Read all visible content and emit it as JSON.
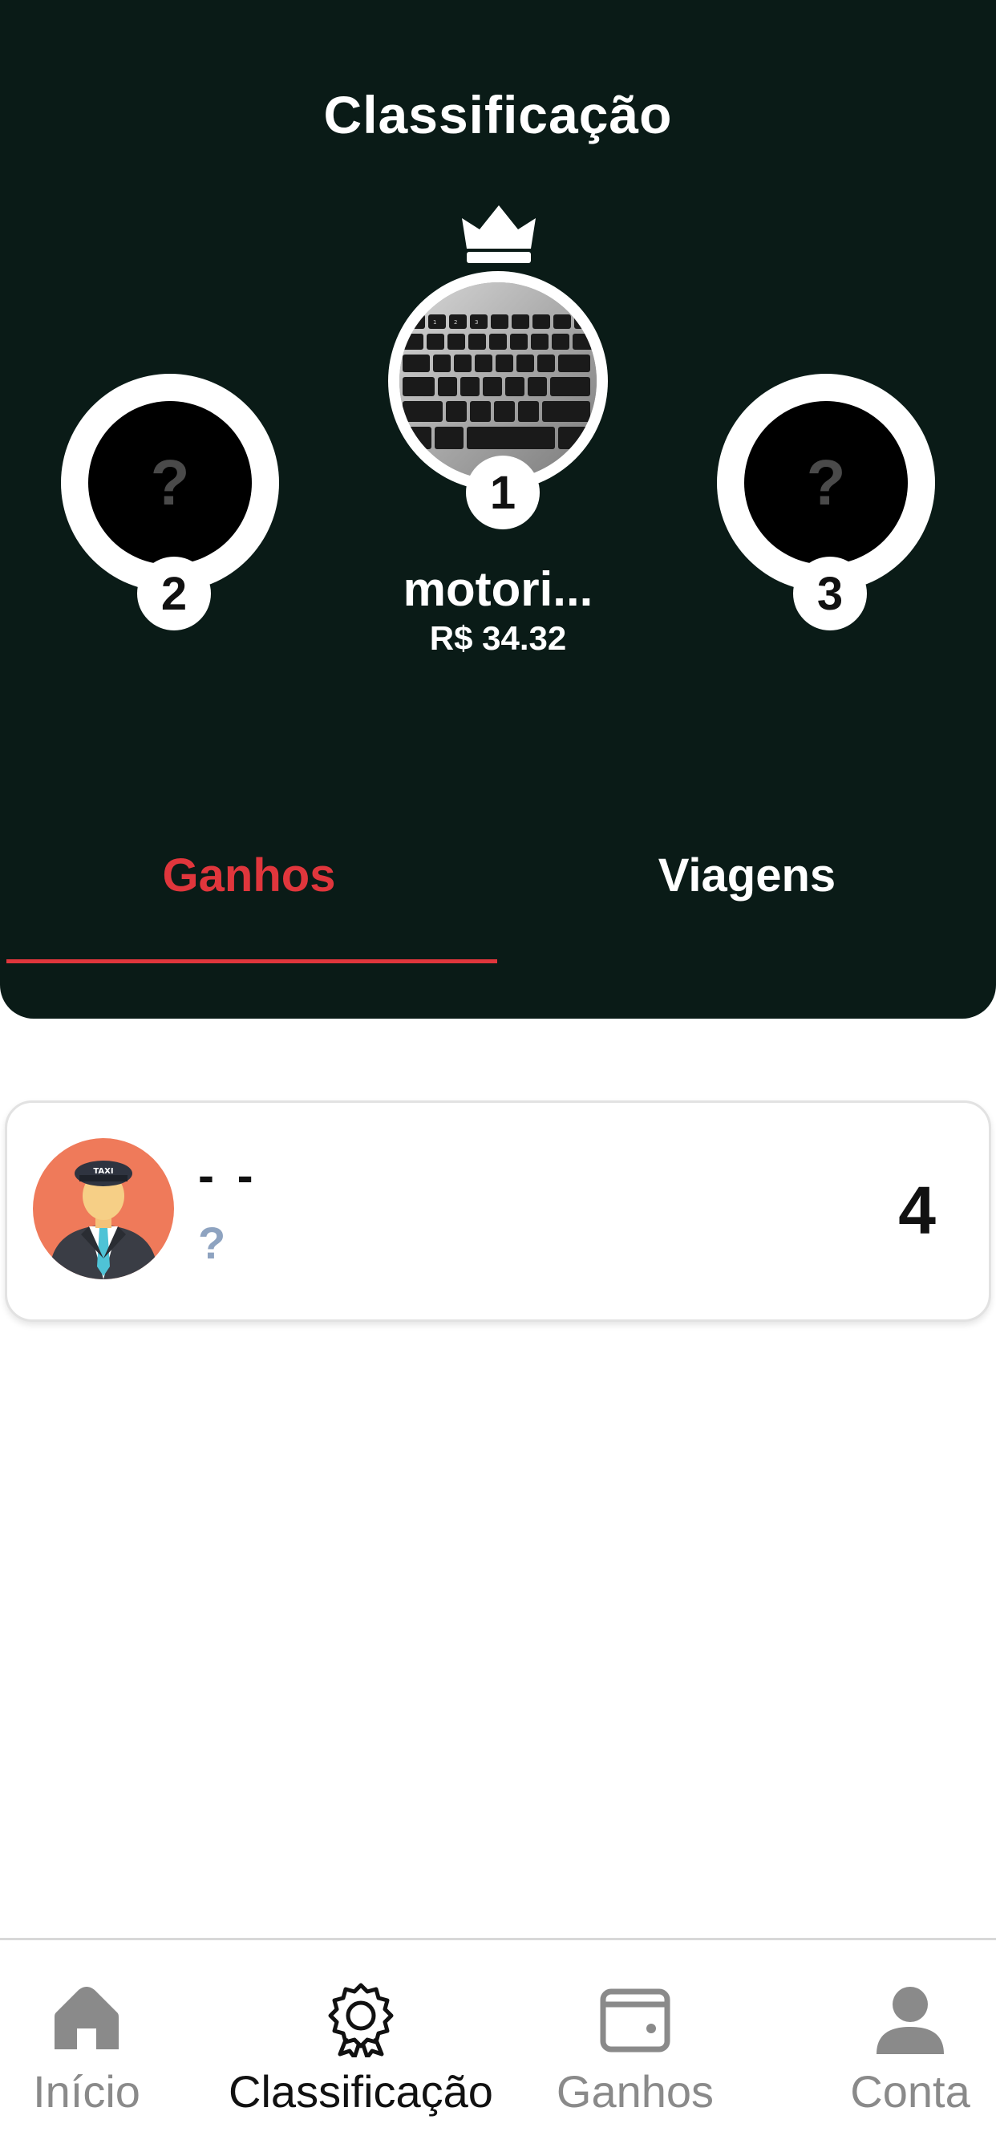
{
  "header": {
    "title": "Classificação"
  },
  "podium": {
    "first": {
      "rank": "1",
      "name": "motori...",
      "value": "R$ 34.32"
    },
    "second": {
      "rank": "2",
      "placeholder": "?"
    },
    "third": {
      "rank": "3",
      "placeholder": "?"
    }
  },
  "tabs": [
    {
      "label": "Ganhos",
      "active": true
    },
    {
      "label": "Viagens",
      "active": false
    }
  ],
  "list": [
    {
      "name": "- -",
      "subtitle": "?",
      "rank": "4"
    }
  ],
  "bottom_nav": [
    {
      "label": "Início",
      "icon": "home-icon",
      "active": false
    },
    {
      "label": "Classificação",
      "icon": "award-icon",
      "active": true
    },
    {
      "label": "Ganhos",
      "icon": "wallet-icon",
      "active": false
    },
    {
      "label": "Conta",
      "icon": "user-icon",
      "active": false
    }
  ],
  "colors": {
    "header_bg": "#0a1b17",
    "accent": "#e0363c",
    "subtitle": "#8ea3c0"
  }
}
